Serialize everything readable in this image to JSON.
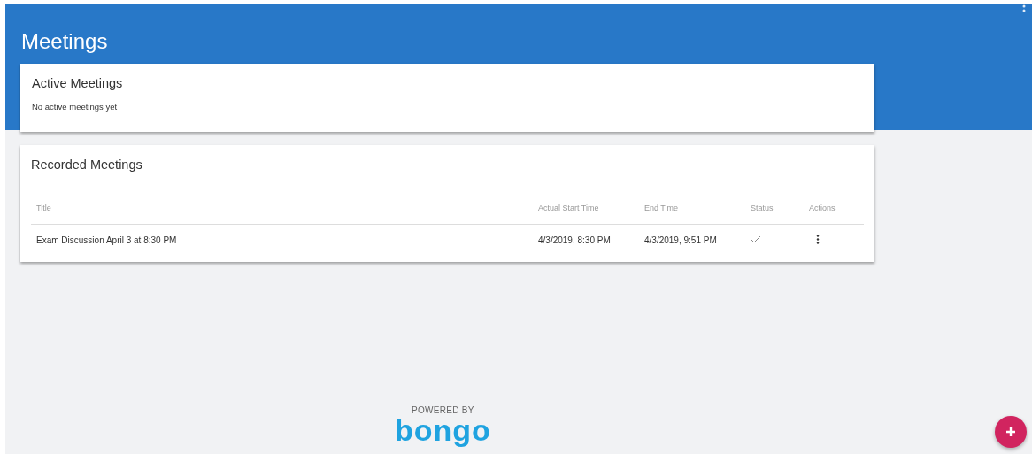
{
  "header": {
    "title": "Meetings"
  },
  "active_meetings": {
    "title": "Active Meetings",
    "empty_message": "No active meetings yet"
  },
  "recorded_meetings": {
    "title": "Recorded Meetings",
    "columns": [
      "Title",
      "Actual Start Time",
      "End Time",
      "Status",
      "Actions"
    ],
    "rows": [
      {
        "title": "Exam Discussion April 3 at 8:30 PM",
        "start": "4/3/2019, 8:30 PM",
        "end": "4/3/2019, 9:51 PM",
        "completed": true
      }
    ]
  },
  "footer": {
    "powered_by": "POWERED BY",
    "brand": "bongo"
  }
}
